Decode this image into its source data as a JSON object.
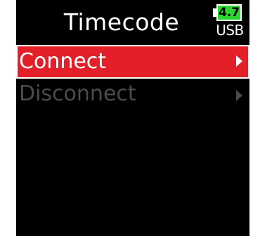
{
  "header": {
    "title": "Timecode",
    "battery": {
      "level": "4.7",
      "source": "USB",
      "fill_color": "#2fd52f"
    }
  },
  "menu": {
    "items": [
      {
        "label": "Connect",
        "state": "selected",
        "icon": "chevron-right-icon"
      },
      {
        "label": "Disconnect",
        "state": "disabled",
        "icon": "chevron-right-icon"
      }
    ]
  },
  "colors": {
    "background": "#000000",
    "selection": "#e3202a",
    "text": "#ffffff",
    "disabled_text": "#4b4b4b"
  }
}
